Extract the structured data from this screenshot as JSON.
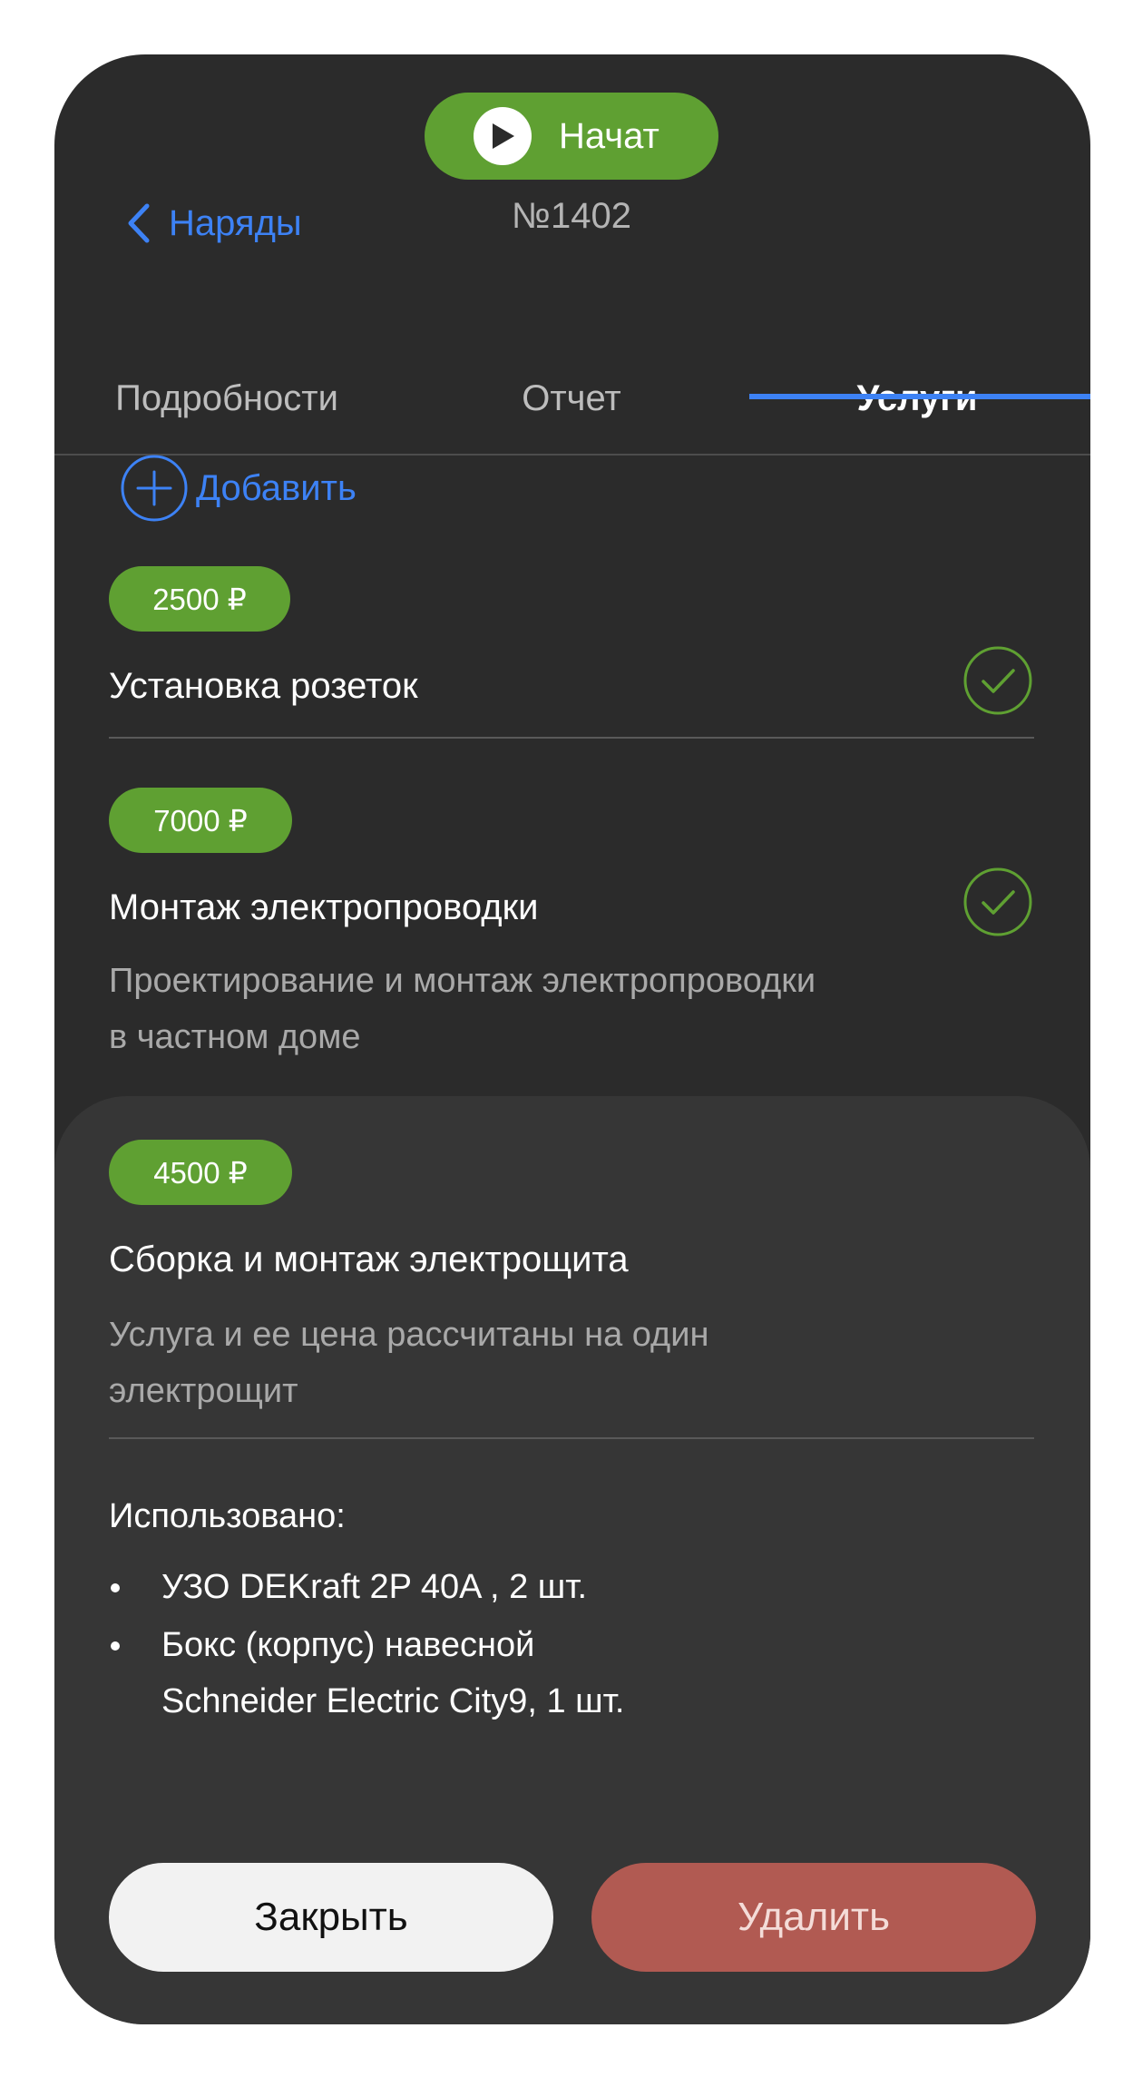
{
  "header": {
    "back_label": "Наряды",
    "status_label": "Начат",
    "order_number": "№1402"
  },
  "tabs": [
    {
      "label": "Подробности",
      "active": false
    },
    {
      "label": "Отчет",
      "active": false
    },
    {
      "label": "Услуги",
      "active": true
    }
  ],
  "add_label": "Добавить",
  "services": [
    {
      "price": "2500 ₽",
      "title": "Установка розеток",
      "description": "",
      "done": true
    },
    {
      "price": "7000 ₽",
      "title": "Монтаж электропроводки",
      "description": "Проектирование и монтаж электропроводки в частном доме",
      "done": true
    }
  ],
  "sheet": {
    "price": "4500 ₽",
    "title": "Сборка и монтаж электрощита",
    "description": "Услуга и ее цена рассчитаны на один электрощит",
    "used_title": "Использовано:",
    "used_items": [
      "УЗО DEKraft 2P 40A , 2 шт.",
      "Бокс (корпус) навесной Schneider Electric City9, 1 шт."
    ],
    "close_label": "Закрыть",
    "delete_label": "Удалить"
  },
  "colors": {
    "background": "#2b2b2b",
    "sheet": "#363636",
    "accent_blue": "#3d82f5",
    "accent_green": "#5fa032",
    "delete_red": "#b15a52"
  },
  "icons": [
    "chevron-left-icon",
    "play-icon",
    "plus-circle-icon",
    "check-circle-icon"
  ]
}
